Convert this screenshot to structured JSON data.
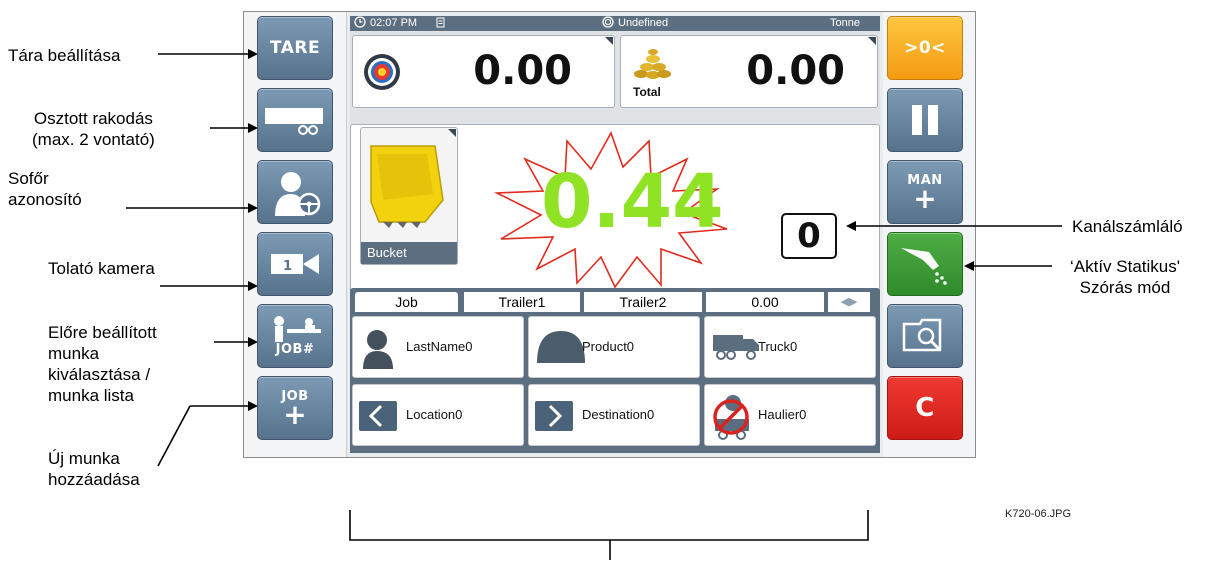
{
  "annotations": {
    "tare": "Tára beállítása",
    "split_loading": [
      "Osztott rakodás",
      "(max. 2 vontató)"
    ],
    "driver_id": [
      "Sofőr",
      "azonosító"
    ],
    "reverse_camera": "Tolató kamera",
    "preset_job": [
      "Előre beállított",
      "munka",
      "kiválasztása /",
      "munka lista"
    ],
    "new_job": [
      "Új munka",
      "hozzáadása"
    ],
    "bucket_counter": "Kanálszámláló",
    "active_static": [
      "‘Aktív Statikus'",
      "Szórás mód"
    ]
  },
  "file_name": "K720-06.JPG",
  "status_bar": {
    "time": "02:07 PM",
    "center": "Undefined",
    "unit": "Tonne"
  },
  "left_buttons": {
    "tare": "TARE",
    "job_select": "JOB#",
    "job_add": "JOB",
    "job_add_plus": "+"
  },
  "right_buttons": {
    "zero": ">0<",
    "man": "MAN",
    "man_plus": "+",
    "clear": "C"
  },
  "target_value": "0.00",
  "total_value": "0.00",
  "total_label": "Total",
  "bucket_label": "Bucket",
  "main_weight": "0.44",
  "bucket_count": "0",
  "tabs": [
    "Job",
    "Trailer1",
    "Trailer2",
    "0.00"
  ],
  "cells": [
    "LastName0",
    "Product0",
    "Truck0",
    "Location0",
    "Destination0",
    "Haulier0"
  ],
  "colors": {
    "zero_btn": "#f5a81e",
    "spread_btn": "#3f9a3a",
    "clear_btn": "#e0211d",
    "main_value": "#8fe324",
    "status_bar": "#5c6f80"
  }
}
